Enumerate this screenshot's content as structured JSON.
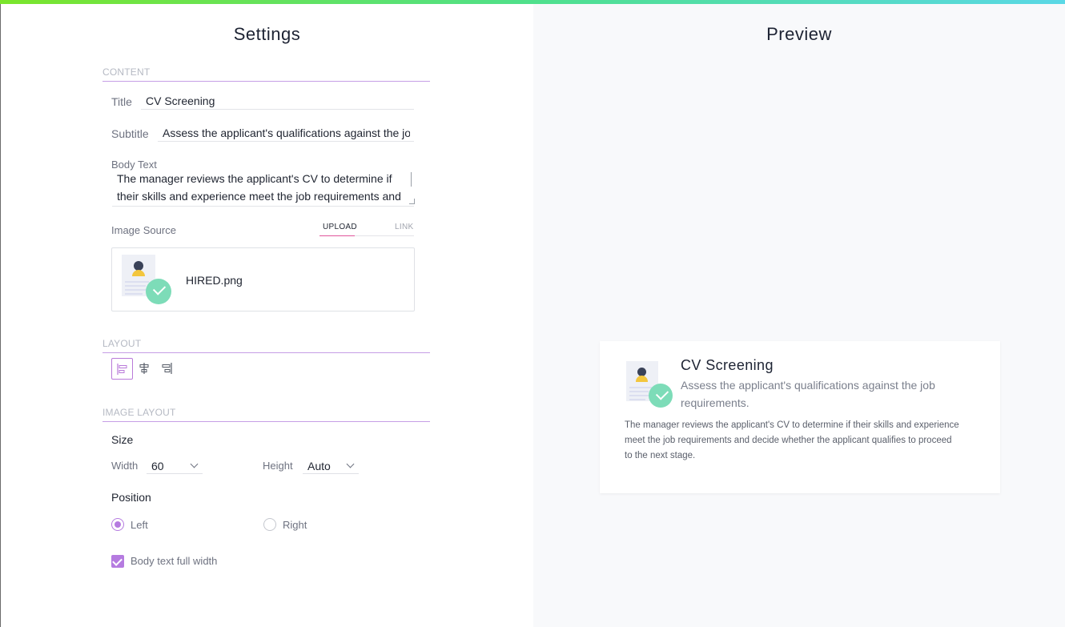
{
  "theme": {
    "accent": "#b57be0",
    "accent_rule": "#c69ee6",
    "check_green": "#7ddcb8",
    "avatar_yellow": "#f3c63d"
  },
  "settings": {
    "title": "Settings",
    "content_section": "CONTENT",
    "title_label": "Title",
    "title_value": "CV Screening",
    "subtitle_label": "Subtitle",
    "subtitle_value": "Assess the applicant's qualifications against the job requirements.",
    "body_label": "Body Text",
    "body_value": "The manager reviews the applicant's CV to determine if their skills and experience meet the job requirements and decide whether the applicant qualifies to proceed to the next stage.",
    "image_source_label": "Image Source",
    "tab_upload": "UPLOAD",
    "tab_link": "LINK",
    "file_name": "HIRED.png",
    "file_icon": "cv-check-icon",
    "layout_section": "LAYOUT",
    "layout_options": [
      "align-left-icon",
      "align-center-icon",
      "align-right-icon"
    ],
    "image_layout_section": "IMAGE LAYOUT",
    "size_heading": "Size",
    "width_label": "Width",
    "width_value": "60",
    "height_label": "Height",
    "height_value": "Auto",
    "position_heading": "Position",
    "position_left": "Left",
    "position_right": "Right",
    "body_full_width_label": "Body text full width"
  },
  "preview": {
    "title": "Preview",
    "card_title": "CV Screening",
    "card_subtitle": "Assess the applicant's qualifications against the job requirements.",
    "card_body": "The manager reviews the applicant's CV to determine if their skills and experience meet the job requirements and decide whether the applicant qualifies to proceed to the next stage."
  }
}
